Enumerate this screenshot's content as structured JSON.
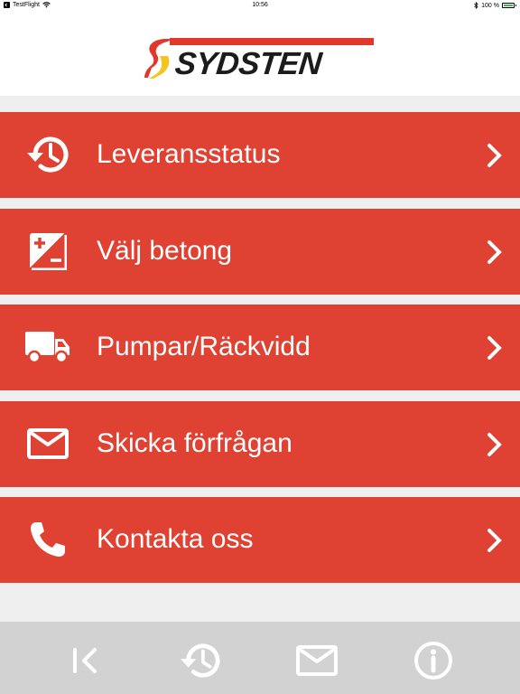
{
  "status_bar": {
    "carrier": "TestFlight",
    "time": "10:56",
    "battery": "100 %",
    "battery_level": 1.0
  },
  "header": {
    "logo_text": "SYDSTEN",
    "brand_colors": {
      "red": "#e2372b",
      "yellow": "#f4c41f",
      "dark": "#1c1c1c"
    }
  },
  "menu": {
    "item_color": "#df4132",
    "items": [
      {
        "label": "Leveransstatus",
        "icon": "history-icon"
      },
      {
        "label": "Välj betong",
        "icon": "plus-minus-icon"
      },
      {
        "label": "Pumpar/Räckvidd",
        "icon": "truck-icon"
      },
      {
        "label": "Skicka förfrågan",
        "icon": "mail-icon"
      },
      {
        "label": "Kontakta oss",
        "icon": "phone-icon"
      }
    ]
  },
  "tab_bar": {
    "background": "#d2d2d2",
    "items": [
      {
        "icon": "back-to-start-icon"
      },
      {
        "icon": "history-icon"
      },
      {
        "icon": "mail-icon"
      },
      {
        "icon": "info-icon"
      }
    ]
  }
}
